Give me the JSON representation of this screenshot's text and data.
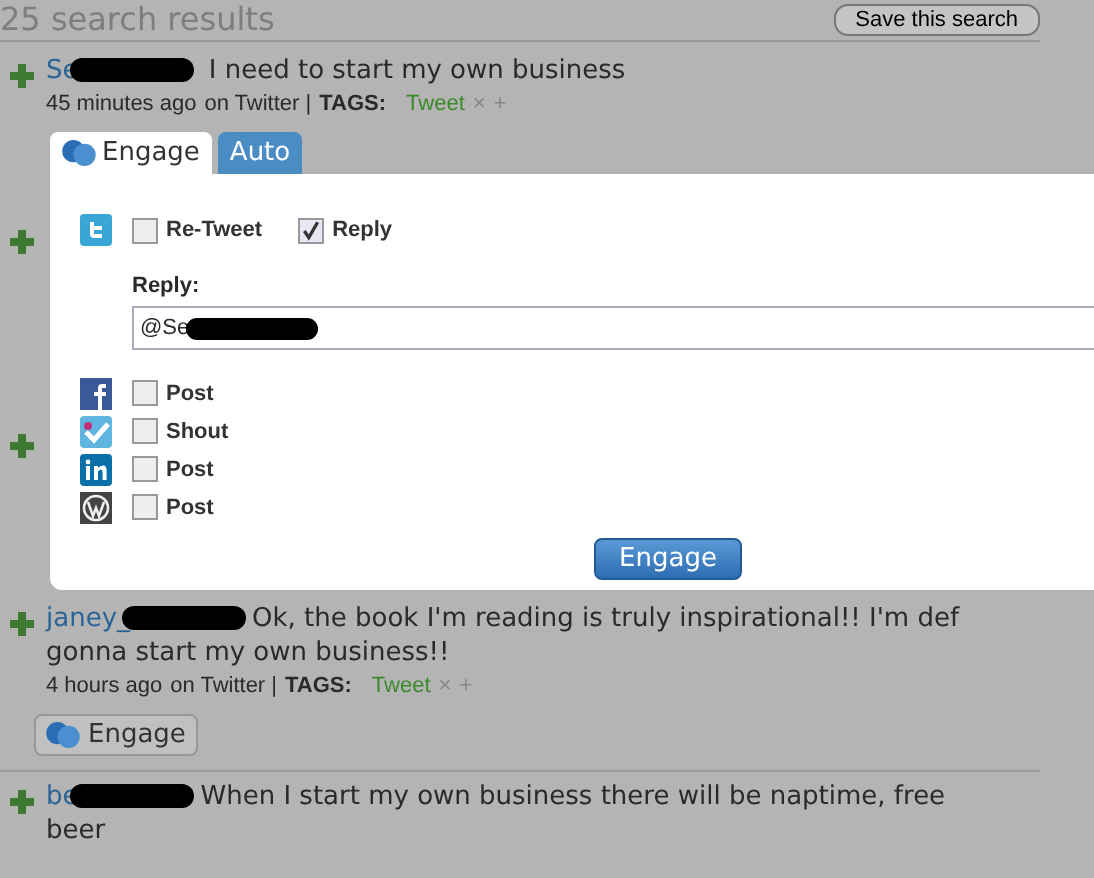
{
  "header": {
    "title": "25 search results",
    "save_button": "Save this search"
  },
  "results": [
    {
      "author": "Se",
      "text": "I need to start my own business",
      "time": "45 minutes ago",
      "source": "on Twitter |",
      "tags_label": "TAGS:",
      "tags": [
        "Tweet"
      ],
      "tag_remove": "×",
      "tag_add": "+"
    },
    {
      "author": "janey_",
      "text": "Ok, the book I'm reading is truly inspirational!! I'm def gonna start my own business!!",
      "time": "4 hours ago",
      "source": "on Twitter |",
      "tags_label": "TAGS:",
      "tags": [
        "Tweet"
      ],
      "tag_remove": "×",
      "tag_add": "+",
      "button": "Engage"
    },
    {
      "author": "be",
      "text": "When I start my own business there will be naptime, free beer"
    }
  ],
  "panel": {
    "tabs": [
      {
        "label": "Engage",
        "selected": true
      },
      {
        "label": "Auto",
        "selected": false
      }
    ],
    "twitter_options": [
      {
        "label": "Re-Tweet",
        "checked": false
      },
      {
        "label": "Reply",
        "checked": true
      }
    ],
    "reply_label": "Reply:",
    "reply_value": "@Se",
    "networks": [
      {
        "kind": "facebook",
        "label": "Post",
        "checked": false
      },
      {
        "kind": "foursquare",
        "label": "Shout",
        "checked": false
      },
      {
        "kind": "linkedin",
        "label": "Post",
        "checked": false
      },
      {
        "kind": "wordpress",
        "label": "Post",
        "checked": false
      }
    ],
    "submit": "Engage"
  }
}
